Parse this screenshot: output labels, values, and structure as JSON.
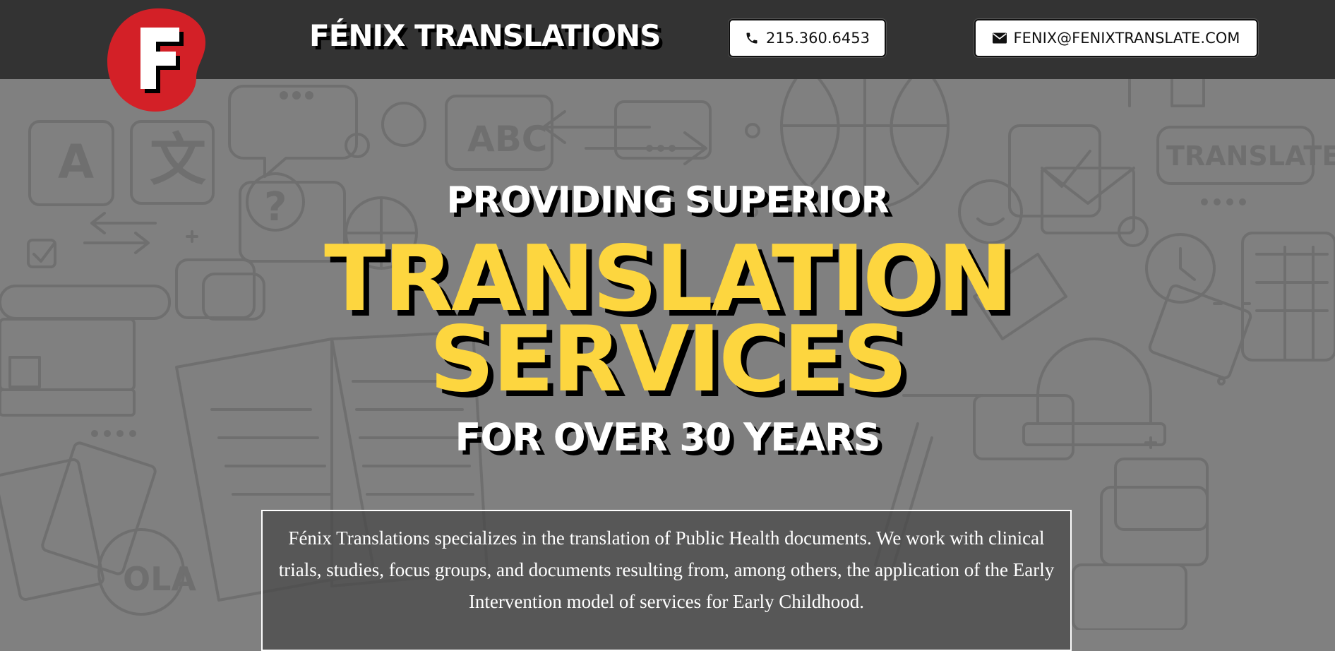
{
  "header": {
    "logo_letter": "F",
    "site_title": "FÉNIX TRANSLATIONS",
    "phone": {
      "label": "215.360.6453",
      "icon": "phone-icon"
    },
    "email": {
      "label": "FENIX@FENIXTRANSLATE.COM",
      "icon": "envelope-icon"
    }
  },
  "hero": {
    "line1": "PROVIDING SUPERIOR",
    "line2": "TRANSLATION",
    "line3": "SERVICES",
    "line4": "FOR OVER 30 YEARS"
  },
  "description": "Fénix Translations specializes in the translation of Public Health documents. We work with clinical trials, studies, focus groups, and documents resulting from, among others, the application of the Early Intervention model of services for Early Childhood.",
  "background_doodles": {
    "letter_a": "A",
    "letter_zh": "文",
    "abc": "ABC",
    "translate": "TRANSLATE...",
    "ola": "OLA",
    "question": "?"
  },
  "colors": {
    "header_bg": "#333333",
    "page_bg": "#808080",
    "accent_yellow": "#fdd63f",
    "logo_red": "#d32027"
  }
}
